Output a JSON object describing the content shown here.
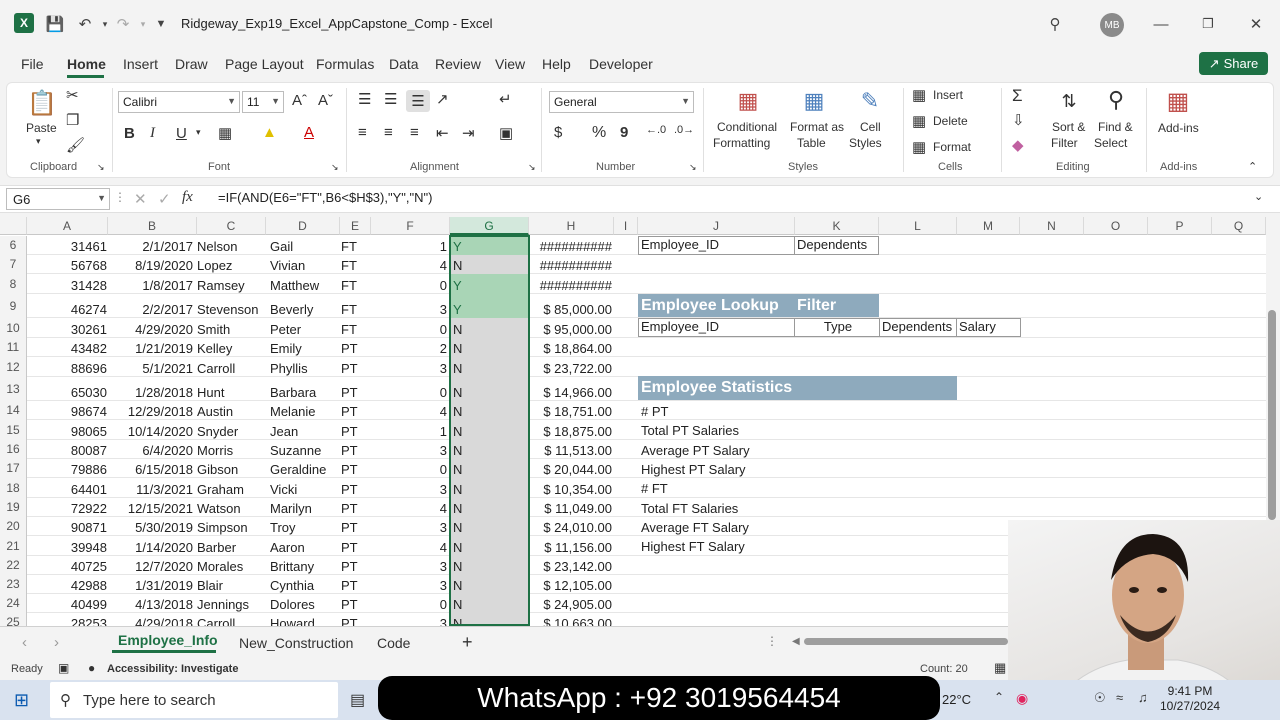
{
  "titlebar": {
    "title": "Ridgeway_Exp19_Excel_AppCapstone_Comp  -  Excel",
    "avatar": "MB",
    "qat": [
      "save-icon",
      "undo-icon",
      "redo-icon",
      "customize-icon"
    ]
  },
  "ribbon_tabs": [
    "File",
    "Home",
    "Insert",
    "Draw",
    "Page Layout",
    "Formulas",
    "Data",
    "Review",
    "View",
    "Help",
    "Developer"
  ],
  "active_tab": "Home",
  "share_label": "Share",
  "ribbon": {
    "clipboard": {
      "paste": "Paste",
      "label": "Clipboard"
    },
    "font": {
      "name": "Calibri",
      "size": "11",
      "label": "Font"
    },
    "alignment": {
      "label": "Alignment"
    },
    "number": {
      "format": "General",
      "label": "Number",
      "currency": "$",
      "percent": "%",
      "comma": "9"
    },
    "styles": {
      "conditional": "Conditional",
      "formatting": "Formatting",
      "format_as": "Format as",
      "table": "Table",
      "cell": "Cell",
      "styles": "Styles",
      "label": "Styles"
    },
    "cells": {
      "insert": "Insert",
      "delete": "Delete",
      "format": "Format",
      "label": "Cells"
    },
    "editing": {
      "sort": "Sort &",
      "filter": "Filter",
      "find": "Find &",
      "select": "Select",
      "label": "Editing"
    },
    "addins": {
      "addins": "Add-ins",
      "label": "Add-ins"
    }
  },
  "formula_bar": {
    "name_box": "G6",
    "formula": "=IF(AND(E6=\"FT\",B6<$H$3),\"Y\",\"N\")"
  },
  "columns": [
    "A",
    "B",
    "C",
    "D",
    "E",
    "F",
    "G",
    "H",
    "I",
    "J",
    "K",
    "L",
    "M",
    "N",
    "O",
    "P",
    "Q"
  ],
  "rows": [
    {
      "n": "6",
      "a": "31461",
      "b": "2/1/2017",
      "c": "Nelson",
      "d": "Gail",
      "e": "FT",
      "f": "1",
      "g": "Y",
      "h": "##########",
      "ident": "",
      "j": "Employee_ID",
      "k": "Dependents"
    },
    {
      "n": "7",
      "a": "56768",
      "b": "8/19/2020",
      "c": "Lopez",
      "d": "Vivian",
      "e": "FT",
      "f": "4",
      "g": "N",
      "h": "##########"
    },
    {
      "n": "8",
      "a": "31428",
      "b": "1/8/2017",
      "c": "Ramsey",
      "d": "Matthew",
      "e": "FT",
      "f": "0",
      "g": "Y",
      "h": "##########"
    },
    {
      "n": "9",
      "a": "46274",
      "b": "2/2/2017",
      "c": "Stevenson",
      "d": "Beverly",
      "e": "FT",
      "f": "3",
      "g": "Y",
      "h": "$ 85,000.00"
    },
    {
      "n": "10",
      "a": "30261",
      "b": "4/29/2020",
      "c": "Smith",
      "d": "Peter",
      "e": "FT",
      "f": "0",
      "g": "N",
      "h": "$ 95,000.00"
    },
    {
      "n": "11",
      "a": "43482",
      "b": "1/21/2019",
      "c": "Kelley",
      "d": "Emily",
      "e": "PT",
      "f": "2",
      "g": "N",
      "h": "$ 18,864.00"
    },
    {
      "n": "12",
      "a": "88696",
      "b": "5/1/2021",
      "c": "Carroll",
      "d": "Phyllis",
      "e": "PT",
      "f": "3",
      "g": "N",
      "h": "$ 23,722.00"
    },
    {
      "n": "13",
      "a": "65030",
      "b": "1/28/2018",
      "c": "Hunt",
      "d": "Barbara",
      "e": "PT",
      "f": "0",
      "g": "N",
      "h": "$ 14,966.00"
    },
    {
      "n": "14",
      "a": "98674",
      "b": "12/29/2018",
      "c": "Austin",
      "d": "Melanie",
      "e": "PT",
      "f": "4",
      "g": "N",
      "h": "$ 18,751.00"
    },
    {
      "n": "15",
      "a": "98065",
      "b": "10/14/2020",
      "c": "Snyder",
      "d": "Jean",
      "e": "PT",
      "f": "1",
      "g": "N",
      "h": "$ 18,875.00"
    },
    {
      "n": "16",
      "a": "80087",
      "b": "6/4/2020",
      "c": "Morris",
      "d": "Suzanne",
      "e": "PT",
      "f": "3",
      "g": "N",
      "h": "$ 11,513.00"
    },
    {
      "n": "17",
      "a": "79886",
      "b": "6/15/2018",
      "c": "Gibson",
      "d": "Geraldine",
      "e": "PT",
      "f": "0",
      "g": "N",
      "h": "$ 20,044.00"
    },
    {
      "n": "18",
      "a": "64401",
      "b": "11/3/2021",
      "c": "Graham",
      "d": "Vicki",
      "e": "PT",
      "f": "3",
      "g": "N",
      "h": "$ 10,354.00"
    },
    {
      "n": "19",
      "a": "72922",
      "b": "12/15/2021",
      "c": "Watson",
      "d": "Marilyn",
      "e": "PT",
      "f": "4",
      "g": "N",
      "h": "$ 11,049.00"
    },
    {
      "n": "20",
      "a": "90871",
      "b": "5/30/2019",
      "c": "Simpson",
      "d": "Troy",
      "e": "PT",
      "f": "3",
      "g": "N",
      "h": "$ 24,010.00"
    },
    {
      "n": "21",
      "a": "39948",
      "b": "1/14/2020",
      "c": "Barber",
      "d": "Aaron",
      "e": "PT",
      "f": "4",
      "g": "N",
      "h": "$ 11,156.00"
    },
    {
      "n": "22",
      "a": "40725",
      "b": "12/7/2020",
      "c": "Morales",
      "d": "Brittany",
      "e": "PT",
      "f": "3",
      "g": "N",
      "h": "$ 23,142.00"
    },
    {
      "n": "23",
      "a": "42988",
      "b": "1/31/2019",
      "c": "Blair",
      "d": "Cynthia",
      "e": "PT",
      "f": "3",
      "g": "N",
      "h": "$ 12,105.00"
    },
    {
      "n": "24",
      "a": "40499",
      "b": "4/13/2018",
      "c": "Jennings",
      "d": "Dolores",
      "e": "PT",
      "f": "0",
      "g": "N",
      "h": "$ 24,905.00"
    },
    {
      "n": "25",
      "a": "28253",
      "b": "4/29/2018",
      "c": "Carroll",
      "d": "Howard",
      "e": "PT",
      "f": "3",
      "g": "N",
      "h": "$ 10,663.00"
    }
  ],
  "lookup": {
    "title": "Employee Lookup",
    "filter": "Filter",
    "headers": [
      "Employee_ID",
      "Type",
      "Dependents",
      "Salary"
    ]
  },
  "statistics": {
    "title": "Employee Statistics",
    "items": [
      "# PT",
      "Total PT Salaries",
      "Average PT Salary",
      "Highest PT Salary",
      "# FT",
      "Total FT Salaries",
      "Average FT Salary",
      "Highest FT Salary"
    ]
  },
  "sheet_tabs": [
    "Employee_Info",
    "New_Construction",
    "Code"
  ],
  "active_sheet": "Employee_Info",
  "status": {
    "ready": "Ready",
    "accessibility": "Accessibility: Investigate",
    "count": "Count: 20"
  },
  "taskbar": {
    "search_placeholder": "Type here to search",
    "banner": "WhatsApp :  +92  3019564454",
    "temp": "22°C",
    "time": "9:41 PM",
    "date": "10/27/2024"
  }
}
